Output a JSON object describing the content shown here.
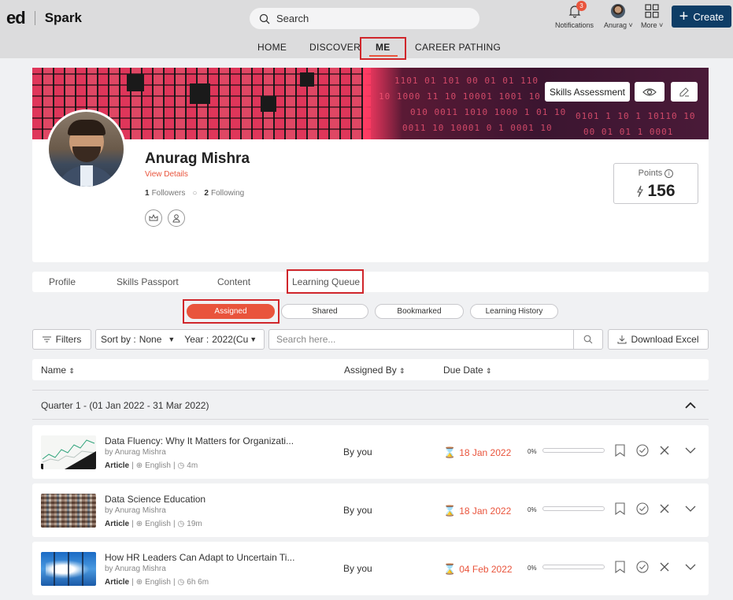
{
  "topbar": {
    "logo_ed": "ed",
    "logo_spark": "Spark",
    "search_placeholder": "Search",
    "notifications": {
      "label": "Notifications",
      "count": "3"
    },
    "user": {
      "label": "Anurag"
    },
    "more": {
      "label": "More"
    },
    "create_label": "Create"
  },
  "nav": {
    "items": [
      "HOME",
      "DISCOVER",
      "ME",
      "CAREER PATHING"
    ],
    "active": "ME"
  },
  "profile": {
    "skills_assessment": "Skills Assessment",
    "name": "Anurag Mishra",
    "view_details": "View Details",
    "followers_count": "1",
    "followers_label": "Followers",
    "following_count": "2",
    "following_label": "Following",
    "points_label": "Points",
    "points_value": "156"
  },
  "tabs": {
    "items": [
      "Profile",
      "Skills Passport",
      "Content",
      "Learning Queue"
    ],
    "active": "Learning Queue"
  },
  "subtabs": {
    "items": [
      "Assigned",
      "Shared",
      "Bookmarked",
      "Learning History"
    ],
    "active": "Assigned"
  },
  "toolbar": {
    "filters": "Filters",
    "sort_label": "Sort by :",
    "sort_value": "None",
    "year_label": "Year :",
    "year_value": "2022(Cu",
    "search_placeholder": "Search here...",
    "download": "Download Excel"
  },
  "table": {
    "headers": {
      "name": "Name",
      "assigned_by": "Assigned By",
      "due_date": "Due Date"
    },
    "group": "Quarter 1 - (01 Jan 2022 - 31 Mar 2022)",
    "rows": [
      {
        "title": "Data Fluency: Why It Matters for Organizati...",
        "by": "by Anurag Mishra",
        "type": "Article",
        "lang": "English",
        "duration": "4m",
        "assigned_by": "By you",
        "due": "18 Jan 2022",
        "progress": "0%"
      },
      {
        "title": "Data Science Education",
        "by": "by Anurag Mishra",
        "type": "Article",
        "lang": "English",
        "duration": "19m",
        "assigned_by": "By you",
        "due": "18 Jan 2022",
        "progress": "0%"
      },
      {
        "title": "How HR Leaders Can Adapt to Uncertain Ti...",
        "by": "by Anurag Mishra",
        "type": "Article",
        "lang": "English",
        "duration": "6h 6m",
        "assigned_by": "By you",
        "due": "04 Feb 2022",
        "progress": "0%"
      }
    ]
  },
  "colors": {
    "accent": "#e9543c",
    "brand": "#0e3d66",
    "highlight": "#d0262b"
  }
}
